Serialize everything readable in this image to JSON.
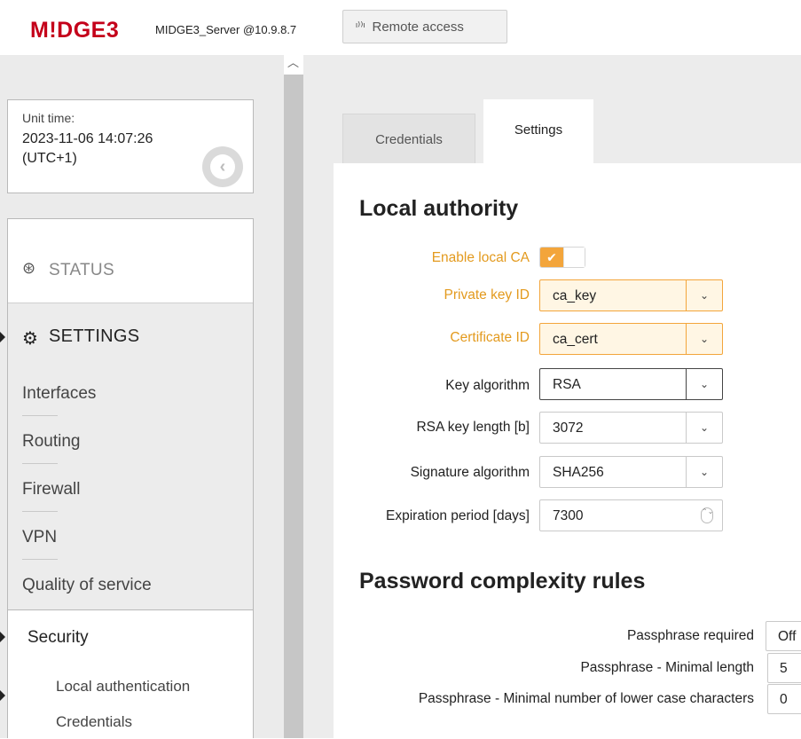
{
  "header": {
    "logo_prefix": "M",
    "logo_excl": "!",
    "logo_main": "DGE",
    "logo_num": "3",
    "server_label": "MIDGE3_Server @10.9.8.7",
    "remote_icon": "antenna-signal-icon",
    "remote_glyph": "ᶦ⁾⁾ᶦ",
    "remote_label": "Remote access"
  },
  "sidebar": {
    "unit_time_label": "Unit time:",
    "unit_time_value": "2023-11-06 14:07:26 (UTC+1)",
    "collapse_glyph": "‹",
    "status_glyph": "⊛",
    "status_label": "STATUS",
    "settings_glyph": "⚙",
    "settings_label": "SETTINGS",
    "items": [
      {
        "label": "Interfaces"
      },
      {
        "label": "Routing"
      },
      {
        "label": "Firewall"
      },
      {
        "label": "VPN"
      },
      {
        "label": "Quality of service"
      }
    ],
    "security": {
      "label": "Security",
      "items": [
        {
          "label": "Local authentication"
        },
        {
          "label": "Credentials"
        }
      ]
    }
  },
  "tabs": [
    {
      "label": "Credentials",
      "active": false
    },
    {
      "label": "Settings",
      "active": true
    }
  ],
  "local_authority": {
    "title": "Local authority",
    "enable_local_ca": {
      "label": "Enable local CA",
      "checked": true,
      "check_glyph": "✔"
    },
    "private_key_id": {
      "label": "Private key ID",
      "value": "ca_key"
    },
    "certificate_id": {
      "label": "Certificate ID",
      "value": "ca_cert"
    },
    "key_algorithm": {
      "label": "Key algorithm",
      "value": "RSA"
    },
    "rsa_key_length": {
      "label": "RSA key length [b]",
      "value": "3072"
    },
    "signature_algorithm": {
      "label": "Signature algorithm",
      "value": "SHA256"
    },
    "expiration_period": {
      "label": "Expiration period [days]",
      "value": "7300"
    },
    "dropdown_glyph": "⌄",
    "spinner_glyph": "⌃⌄"
  },
  "password_rules": {
    "title": "Password complexity rules",
    "passphrase_required": {
      "label": "Passphrase required",
      "value": "Off"
    },
    "min_length": {
      "label": "Passphrase - Minimal length",
      "value": "5"
    },
    "min_lower": {
      "label": "Passphrase - Minimal number of lower case characters",
      "value": "0"
    }
  },
  "colors": {
    "brand": "#c4001a",
    "accent": "#f3a53b",
    "changed_label": "#e39a1e"
  }
}
